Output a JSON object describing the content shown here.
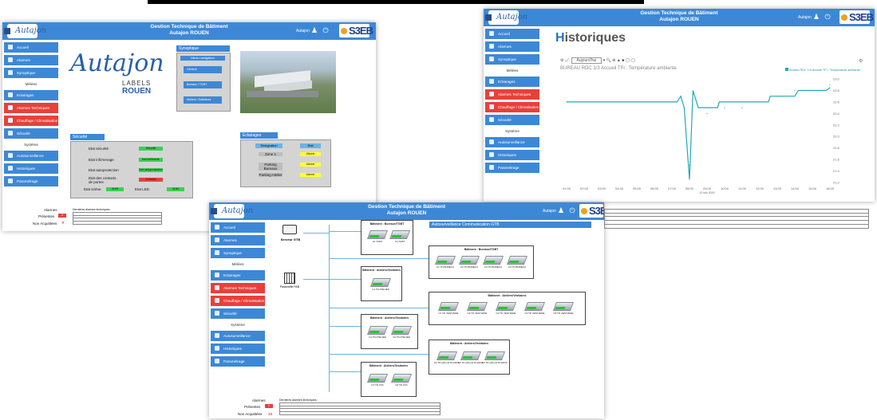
{
  "top_bar_note": "",
  "app": {
    "title_line1": "Gestion Technique de Bâtiment",
    "title_line2": "Autajon ROUEN",
    "user": "Autajon",
    "brand": "S3EB",
    "client_logo": "Autajon"
  },
  "sidebar": {
    "items": [
      {
        "label": "Accueil",
        "style": "blue"
      },
      {
        "label": "Alarmes",
        "style": "blue"
      },
      {
        "label": "Synoptique",
        "style": "blue"
      },
      {
        "label": "Mélées",
        "style": "sub"
      },
      {
        "label": "Eclairages",
        "style": "blue"
      },
      {
        "label": "Alarmes Techniques",
        "style": "red"
      },
      {
        "label": "Chauffage / Climatisation",
        "style": "red"
      },
      {
        "label": "Sécurité",
        "style": "blue"
      },
      {
        "label": "Système",
        "style": "sub"
      },
      {
        "label": "Autosurveillance",
        "style": "blue"
      },
      {
        "label": "Historiques",
        "style": "blue"
      },
      {
        "label": "Paramétrage",
        "style": "blue"
      }
    ]
  },
  "screen1": {
    "logo_text": "Autajon",
    "logo_sub1": "LABELS",
    "logo_sub2": "ROUEN",
    "synoptique_title": "Synoptique",
    "menu_nav_title": "Menu navigation",
    "menu_items": [
      "Général",
      "Bureaux / TGBT",
      "Ateliers / Extérieurs"
    ],
    "securite_title": "Sécurité",
    "securite_rows": [
      {
        "label": "Etat sécurité",
        "status": "Sécurité",
        "color": "green"
      },
      {
        "label": "Etat infirmerage",
        "status": "Non infirmerie",
        "color": "green"
      },
      {
        "label": "Etat autoprotection",
        "status": "Non autoprotection",
        "color": "green"
      },
      {
        "label": "Etat des contacts de portes",
        "status": "Contacts",
        "color": "red"
      }
    ],
    "etat_sirene_label": "Etat sirène",
    "etat_sirene_value": "Arrêt",
    "etat_led_label": "Etat LED",
    "etat_led_value": "Arrêt",
    "eclairages_title": "Eclairages",
    "eclairages_headers": [
      "Désignation",
      "Etat"
    ],
    "eclairages_rows": [
      {
        "name": "Zone 1",
        "state": "Allumé"
      },
      {
        "name": "Parking Bureaux",
        "state": "Allumé"
      },
      {
        "name": "Parking Atelier",
        "state": "Allumé"
      }
    ],
    "alarm_labels": [
      "Alarmes",
      "Présentes",
      "Non Acquittées"
    ],
    "alarm_present_count": "3",
    "alarm_header": "Dernières alarmes techniques :"
  },
  "screen2": {
    "page_title": "Historiques",
    "series_select": "Aujourd'hui",
    "chart_title": "BUREAU RDC 1/3 Accueil TFI : Température ambiante",
    "legend": "Bureau RDC 1/3 Accueil TFI : Température ambiante",
    "color": "#22a8b8"
  },
  "chart_data": {
    "type": "line",
    "title": "BUREAU RDC 1/3 Accueil TFI : Température ambiante",
    "x": [
      "01:00",
      "02:00",
      "03:00",
      "04:00",
      "05:00",
      "06:00",
      "07:00",
      "08:00",
      "09:00",
      "10:00",
      "11:00",
      "12:00",
      "13:00",
      "14:00",
      "15:00",
      "16:00"
    ],
    "series": [
      {
        "name": "Bureau RDC 1/3 Accueil TFI : Température ambiante",
        "values": [
          22.6,
          22.6,
          22.6,
          22.6,
          22.6,
          22.6,
          22.6,
          21.5,
          22.4,
          22.5,
          22.5,
          22.6,
          22.7,
          22.8,
          22.8,
          22.9
        ]
      }
    ],
    "ylim": [
      21.2,
      23.0
    ],
    "yticks": [
      "23.0",
      "22.8",
      "22.6",
      "22.4",
      "22.2",
      "22.0",
      "21.8",
      "21.6",
      "21.4",
      "21.2"
    ],
    "xlabel": "12 juin 2020",
    "legend_position": "top-right",
    "grid": false
  },
  "screen3": {
    "section_title": "Autosurveillance Communication GTB",
    "server_label": "Serveur GTB",
    "passerelle_label": "Passerelle PAB",
    "groups": [
      {
        "title": "Bâtiment : Bureaux/TGBT",
        "devices": [
          "C1 TGBT",
          "C2 TGBT"
        ]
      },
      {
        "title": "Bâtiment : Bureaux/TGBT",
        "devices": [
          "C1 TD BUREAU",
          "C2 TD BUREAU",
          "C3 TD BUREAU",
          "C4 TD BUREAU"
        ]
      },
      {
        "title": "Bâtiment : Ateliers/Vestiaires",
        "devices": [
          "C1 TD ATELIER"
        ]
      },
      {
        "title": "Bâtiment : Ateliers/Vestiaires",
        "devices": [
          "C1 TD VESTIAIRE",
          "C2 TD VESTIAIRE",
          "C3 TD VESTIAIRE",
          "C4 TD VESTIAIRE",
          "C5 TD VESTIAIRE"
        ]
      },
      {
        "title": "Bâtiment : Ateliers/Vestiaires",
        "devices": [
          "C1 TD ATELIER",
          "C2 TD ATELIER"
        ]
      },
      {
        "title": "Bâtiment : Ateliers/Vestiaires",
        "devices": [
          "C1 TD HALLE SCHOOL",
          "C2 TD HALLE SCHOOL",
          "C3 TD HALLE SCHOOL"
        ]
      },
      {
        "title": "Bâtiment : Ateliers/Vestiaires",
        "devices": [
          "C1 TD CTA",
          "C2 TD CTA"
        ]
      }
    ],
    "alarm_present_count": "1",
    "alarm_unack_count": "10"
  }
}
